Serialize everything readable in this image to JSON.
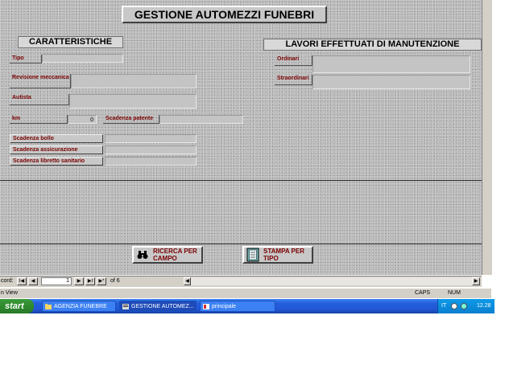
{
  "form": {
    "title": "GESTIONE AUTOMEZZI FUNEBRI",
    "sections": {
      "left": "CARATTERISTICHE",
      "right": "LAVORI EFFETTUATI DI MANUTENZIONE"
    },
    "fields": {
      "tipo": "Tipo",
      "revisione": "Revisione meccanica",
      "autista": "Autista",
      "km": "km",
      "km_value": "0",
      "scadenza_patente": "Scadenza patente",
      "ordinari": "Ordinari",
      "straordinari": "Straordinari",
      "scadenza_bollo": "Scadenza bollo",
      "scadenza_assicurazione": "Scadenza assicurazione",
      "scadenza_libretto": "Scadenza libretto sanitario"
    },
    "buttons": {
      "ricerca": "RICERCA PER\nCAMPO",
      "stampa": "STAMPA PER\nTIPO"
    }
  },
  "navigation": {
    "label": "cord:",
    "current": "1",
    "of_text": "of 6",
    "buttons": {
      "first": "I◀",
      "prev": "◀",
      "next": "▶",
      "last": "▶I",
      "new": "▶*"
    }
  },
  "statusbar": {
    "left": "n View",
    "caps": "CAPS",
    "num": "NUM"
  },
  "taskbar": {
    "start": "start",
    "tasks": [
      "AGENZIA FUNEBRE",
      "GESTIONE AUTOMEZ...",
      "principale"
    ],
    "tray": {
      "lang": "IT",
      "time": "12.28"
    }
  },
  "icons": {
    "ricerca": "binoculars-icon",
    "stampa": "document-icon",
    "folder": "folder-icon",
    "form": "form-icon",
    "report": "report-icon"
  },
  "colors": {
    "label_text": "#7a0000",
    "taskbar": "#245edb",
    "start": "#2f8a2f"
  }
}
